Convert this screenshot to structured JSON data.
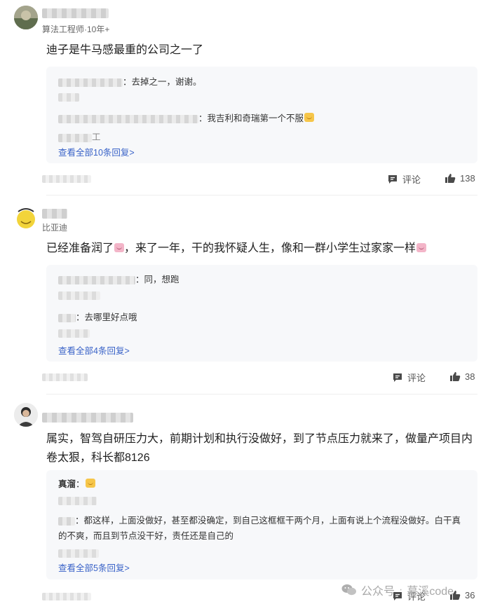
{
  "posts": [
    {
      "meta": "算法工程师·10年+",
      "content": "迪子是牛马感最重的公司之一了",
      "replies": [
        {
          "name": "",
          "text": "去掉之一，谢谢。"
        },
        {
          "name": "",
          "text": "我吉利和奇瑞第一个不服"
        }
      ],
      "reply_suffix_2": "工",
      "more": "查看全部10条回复>",
      "comment_label": "评论",
      "likes": "138"
    },
    {
      "meta": "比亚迪",
      "content": "已经准备润了",
      "content_rest": "，来了一年，干的我怀疑人生，像和一群小学生过家家一样",
      "replies": [
        {
          "name": "",
          "text": "同，想跑"
        },
        {
          "name": "",
          "text": "去哪里好点哦"
        }
      ],
      "more": "查看全部4条回复>",
      "comment_label": "评论",
      "likes": "38"
    },
    {
      "meta": "",
      "content": "属实，智驾自研压力大，前期计划和执行没做好，到了节点压力就来了，做量产项目内卷太狠，科长都8126",
      "replies": [
        {
          "name": "真溜",
          "text": ""
        },
        {
          "name": "",
          "text": "都这样，上面没做好，甚至都没确定，到自己这框框干两个月，上面有说上个流程没做好。白干真的不爽，而且到节点没干好，责任还是自己的"
        }
      ],
      "more": "查看全部5条回复>",
      "comment_label": "评论",
      "likes": "36"
    }
  ],
  "watermark": {
    "brand": "公众号",
    "name": "慕溪code"
  },
  "icons": {
    "comment": "comment-icon",
    "like": "thumbs-up-icon"
  }
}
